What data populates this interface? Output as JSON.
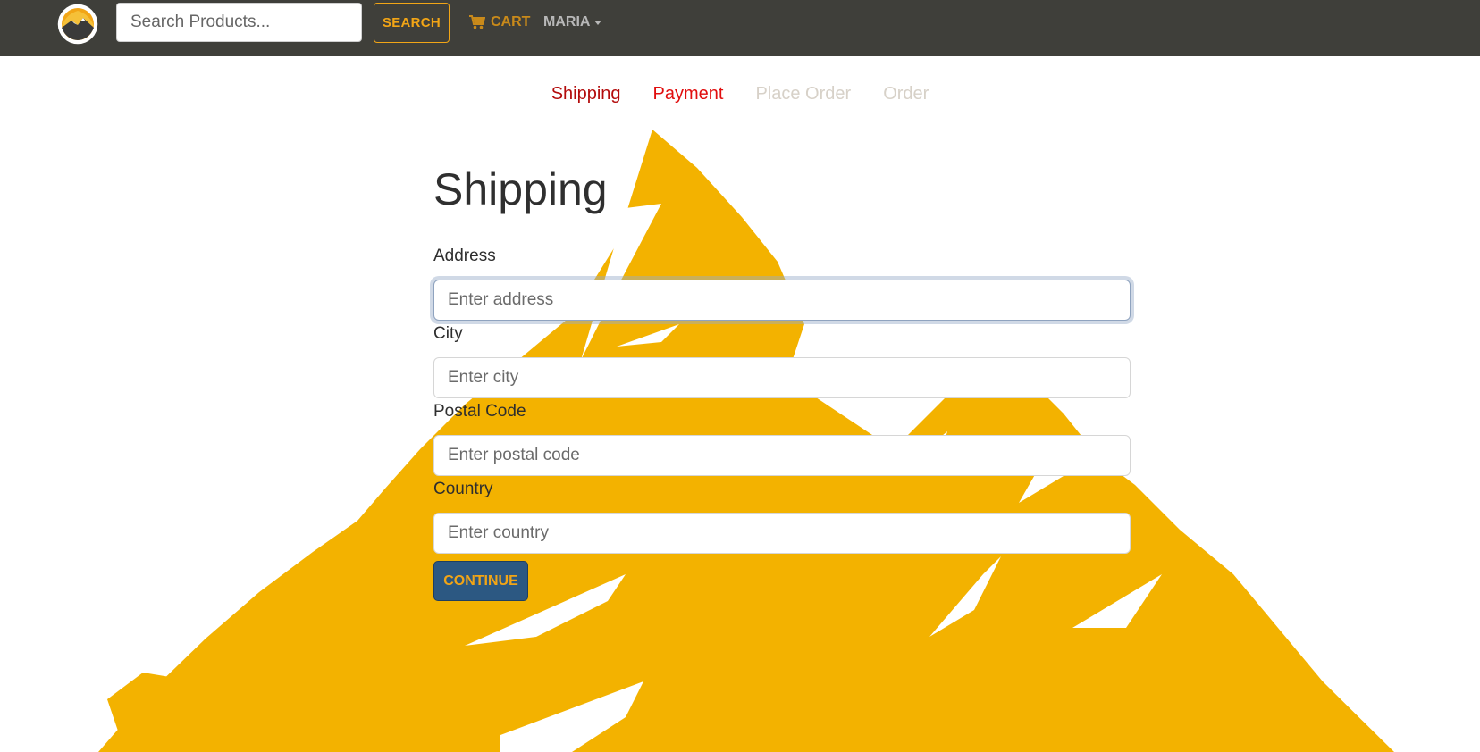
{
  "header": {
    "search": {
      "placeholder": "Search Products...",
      "value": ""
    },
    "search_button_label": "SEARCH",
    "cart_label": "CART",
    "user_menu_label": "MARIA"
  },
  "checkout_steps": [
    {
      "label": "Shipping",
      "state": "active"
    },
    {
      "label": "Payment",
      "state": "enabled"
    },
    {
      "label": "Place Order",
      "state": "disabled"
    },
    {
      "label": "Order",
      "state": "disabled"
    }
  ],
  "form": {
    "title": "Shipping",
    "address": {
      "label": "Address",
      "placeholder": "Enter address",
      "value": ""
    },
    "city": {
      "label": "City",
      "placeholder": "Enter city",
      "value": ""
    },
    "postal_code": {
      "label": "Postal Code",
      "placeholder": "Enter postal code",
      "value": ""
    },
    "country": {
      "label": "Country",
      "placeholder": "Enter country",
      "value": ""
    },
    "submit_label": "CONTINUE"
  },
  "icons": {
    "logo": "mountain-logo-icon",
    "cart": "shopping-cart-icon",
    "user_caret": "caret-down-icon",
    "background": "mountain-background-graphic"
  },
  "colors": {
    "navbar": "#3f3f3a",
    "accent_orange": "#f2a516",
    "mountain_yellow": "#f3b200",
    "step_active": "#b30c0c",
    "step_enabled": "#e10e0e",
    "step_disabled": "#d7d1c8",
    "button_blue": "#2c5882"
  }
}
